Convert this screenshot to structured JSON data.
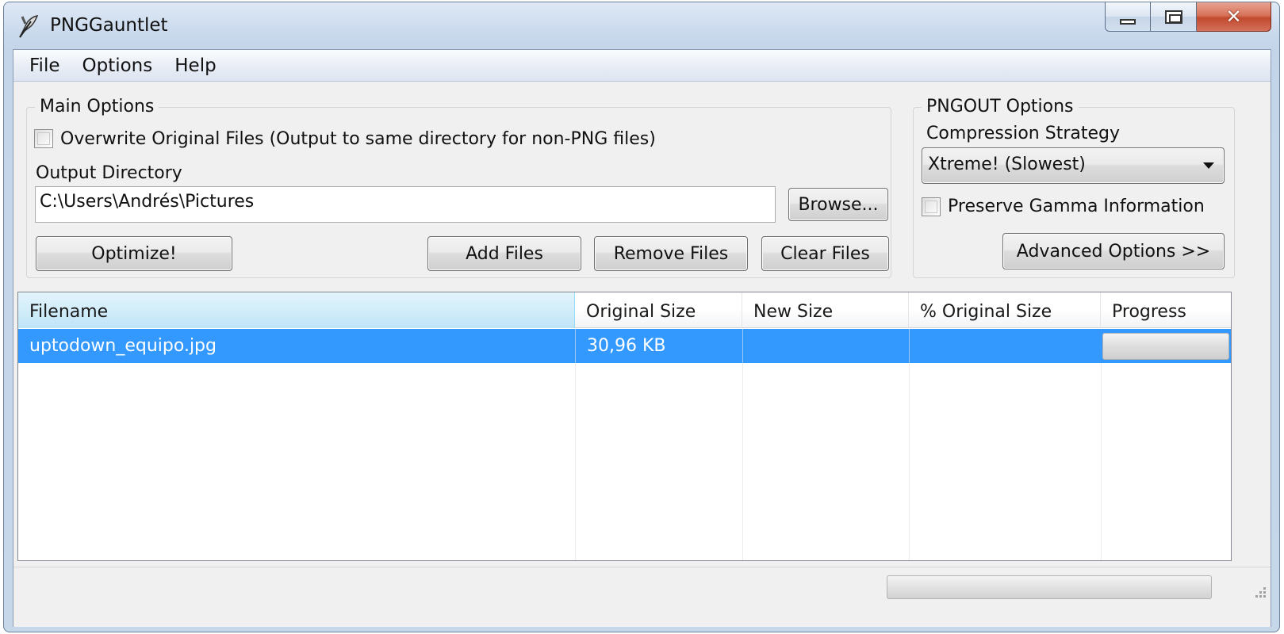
{
  "window": {
    "title": "PNGGauntlet",
    "app_icon": "feather-quill-icon",
    "controls": {
      "minimize_icon": "minimize-icon",
      "maximize_icon": "maximize-icon",
      "close_label": "✕"
    }
  },
  "menu": [
    "File",
    "Options",
    "Help"
  ],
  "main_options": {
    "legend": "Main Options",
    "overwrite_label": "Overwrite Original Files (Output to same directory for non-PNG files)",
    "overwrite_checked": false,
    "output_dir_label": "Output Directory",
    "output_dir_value": "C:\\Users\\Andrés\\Pictures",
    "browse_label": "Browse...",
    "optimize_label": "Optimize!",
    "add_files_label": "Add Files",
    "remove_files_label": "Remove Files",
    "clear_files_label": "Clear Files"
  },
  "pngout_options": {
    "legend": "PNGOUT Options",
    "strategy_label": "Compression Strategy",
    "strategy_value": "Xtreme! (Slowest)",
    "gamma_label": "Preserve Gamma Information",
    "gamma_checked": false,
    "advanced_label": "Advanced Options >>"
  },
  "file_list": {
    "columns": [
      "Filename",
      "Original Size",
      "New Size",
      "% Original Size",
      "Progress"
    ],
    "sorted_column": "Filename",
    "rows": [
      {
        "filename": "uptodown_equipo.jpg",
        "original_size": "30,96 KB",
        "new_size": "",
        "percent": "",
        "progress": 0,
        "selected": true
      }
    ]
  },
  "status": {
    "overall_progress": 0
  },
  "colors": {
    "selection": "#3399ff",
    "title_gradient": "#c4d5ea",
    "close_button": "#c24a2e"
  }
}
